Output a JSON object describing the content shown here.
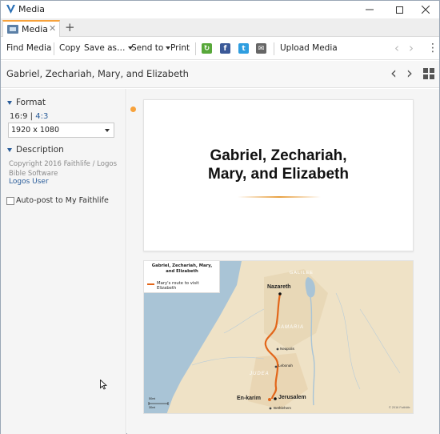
{
  "window": {
    "title": "Media"
  },
  "tab": {
    "label": "Media",
    "close": "✕",
    "add": "+"
  },
  "toolbar": {
    "find_media": "Find Media",
    "copy": "Copy",
    "save_as": "Save as…",
    "send_to": "Send to",
    "print": "Print",
    "upload_media": "Upload Media"
  },
  "header": {
    "title": "Gabriel, Zechariah, Mary, and Elizabeth"
  },
  "sidebar": {
    "format_label": "Format",
    "ratio_a": "16:9",
    "ratio_sep": "|",
    "ratio_b": "4:3",
    "resolution": "1920 x 1080",
    "description_label": "Description",
    "copyright": "Copyright 2016 Faithlife / Logos Bible Software",
    "logos_user": "Logos User",
    "autopost_label": "Auto-post to My Faithlife"
  },
  "slide": {
    "title_line1": "Gabriel, Zechariah,",
    "title_line2": "Mary, and Elizabeth"
  },
  "map": {
    "legend_title_line1": "Gabriel, Zechariah, Mary,",
    "legend_title_line2": "and Elizabeth",
    "legend_route": "Mary's route to visit Elizabeth",
    "galilee": "GALILEE",
    "samaria": "SAMARIA",
    "judea": "JUDEA",
    "nazareth": "Nazareth",
    "neapolis": "Neapolis",
    "lebonah": "Lebonah",
    "en_karim": "En-karim",
    "jerusalem": "Jerusalem",
    "bethlehem": "Bethlehem",
    "credit": "© 2016 Faithlife",
    "scale_km": "50mi",
    "scale_mi": "30mi"
  },
  "colors": {
    "accent": "#f7a23b",
    "link": "#2a5d9a",
    "route": "#e2661a"
  },
  "icons": [
    "logos-app-icon",
    "media-tab-icon",
    "green-share-icon",
    "facebook-icon",
    "twitter-icon",
    "email-icon",
    "back-icon",
    "forward-icon",
    "more-icon",
    "grid-view-icon"
  ]
}
